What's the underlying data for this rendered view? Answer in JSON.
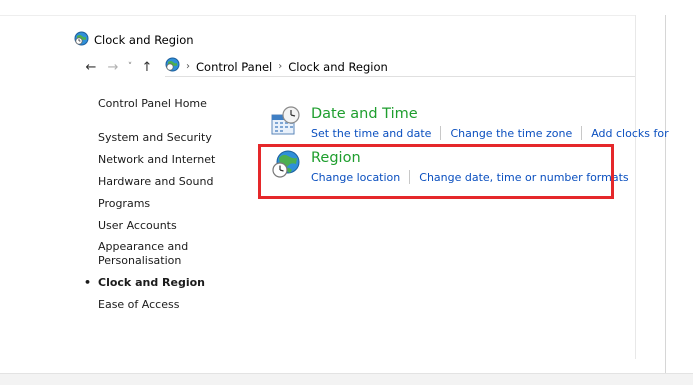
{
  "window": {
    "title": "Clock and Region"
  },
  "navigation": {
    "back": "←",
    "forward": "→",
    "recent": "˅",
    "up": "↑"
  },
  "address": {
    "breadcrumbs": [
      "Control Panel",
      "Clock and Region"
    ],
    "separator": "›"
  },
  "sidebar": {
    "home": "Control Panel Home",
    "items": [
      {
        "label": "System and Security"
      },
      {
        "label": "Network and Internet"
      },
      {
        "label": "Hardware and Sound"
      },
      {
        "label": "Programs"
      },
      {
        "label": "User Accounts"
      },
      {
        "label": "Appearance and Personalisation"
      },
      {
        "label": "Clock and Region",
        "current": true
      },
      {
        "label": "Ease of Access"
      }
    ],
    "current_bullet": "•"
  },
  "categories": [
    {
      "title": "Date and Time",
      "icon": "clock-calendar-icon",
      "links": [
        "Set the time and date",
        "Change the time zone",
        "Add clocks for d"
      ]
    },
    {
      "title": "Region",
      "icon": "globe-clock-icon",
      "links": [
        "Change location",
        "Change date, time or number formats"
      ]
    }
  ],
  "colors": {
    "category_title": "#1e9e2e",
    "link": "#0a4fbf",
    "highlight_border": "#e5282a"
  }
}
